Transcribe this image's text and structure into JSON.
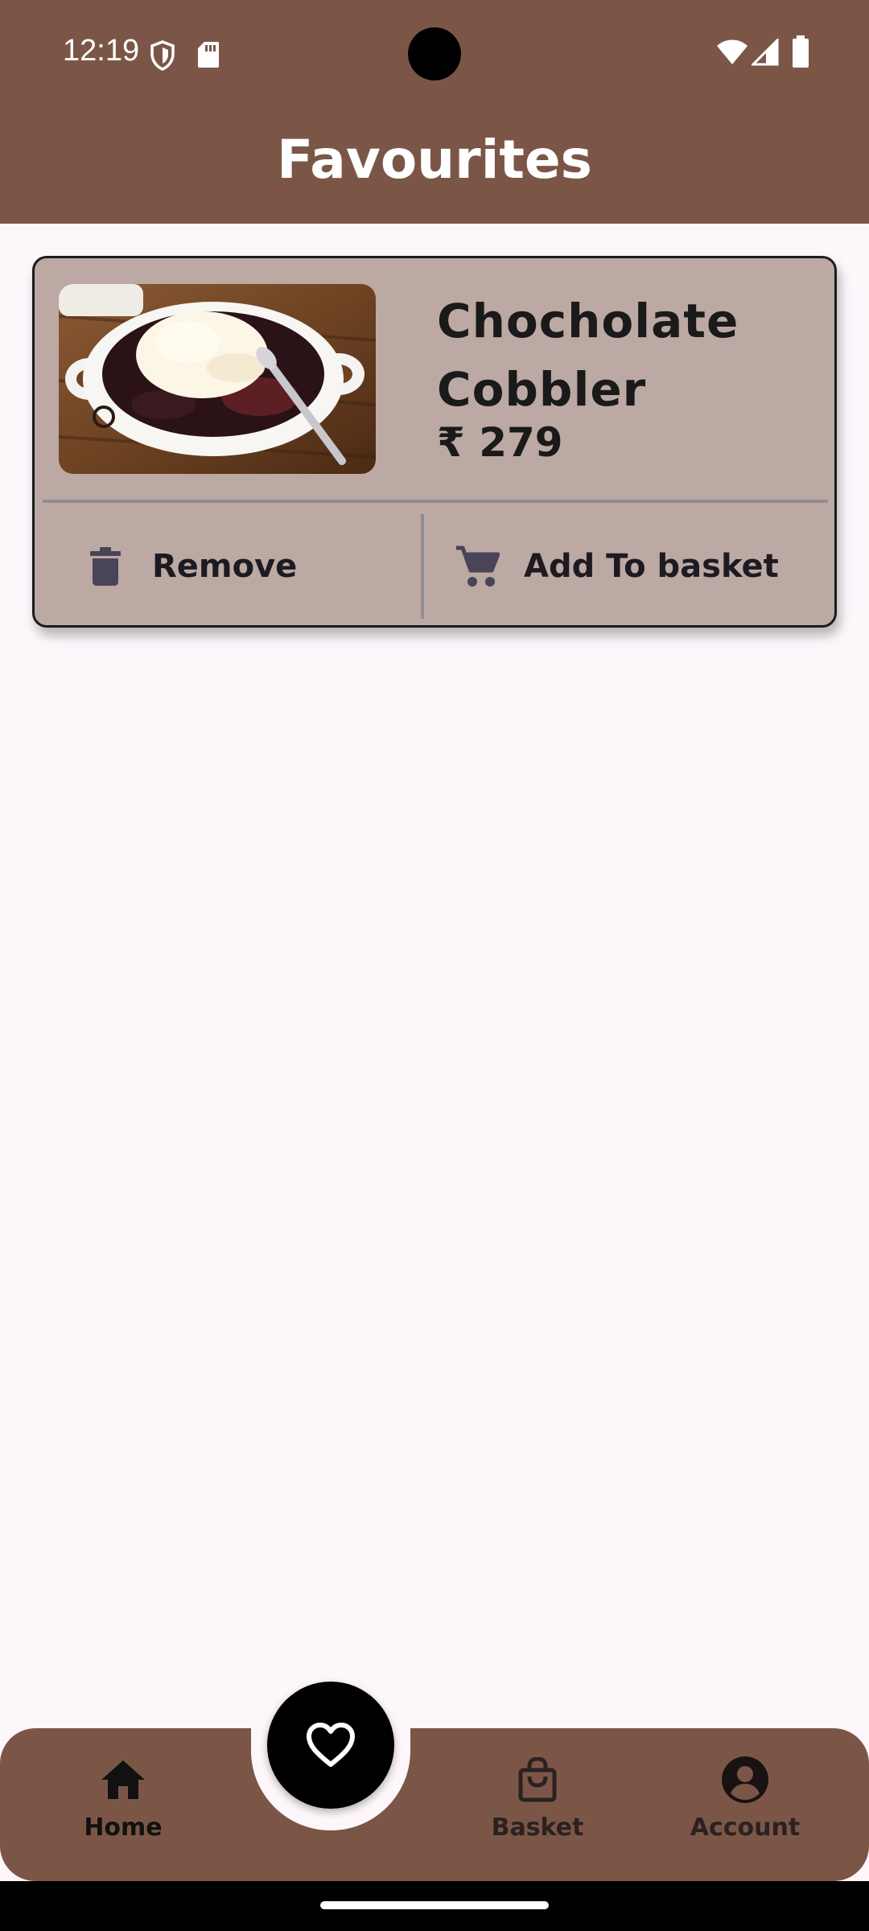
{
  "status_bar": {
    "time": "12:19"
  },
  "app_bar": {
    "title": "Favourites"
  },
  "favourites": [
    {
      "name": "Chocholate Cobbler",
      "price": "₹ 279",
      "remove_label": "Remove",
      "add_label": "Add To basket"
    }
  ],
  "bottom_nav": {
    "items": [
      {
        "label": "Home",
        "icon": "home-icon"
      },
      {
        "label": "Basket",
        "icon": "shopping-bag-icon"
      },
      {
        "label": "Account",
        "icon": "account-circle-icon"
      }
    ],
    "fab_icon": "heart-icon"
  },
  "colors": {
    "app_bar": "#7b5647",
    "card_background": "#bca9a3",
    "page_background": "#fdf7fc",
    "fab": "#000000"
  }
}
